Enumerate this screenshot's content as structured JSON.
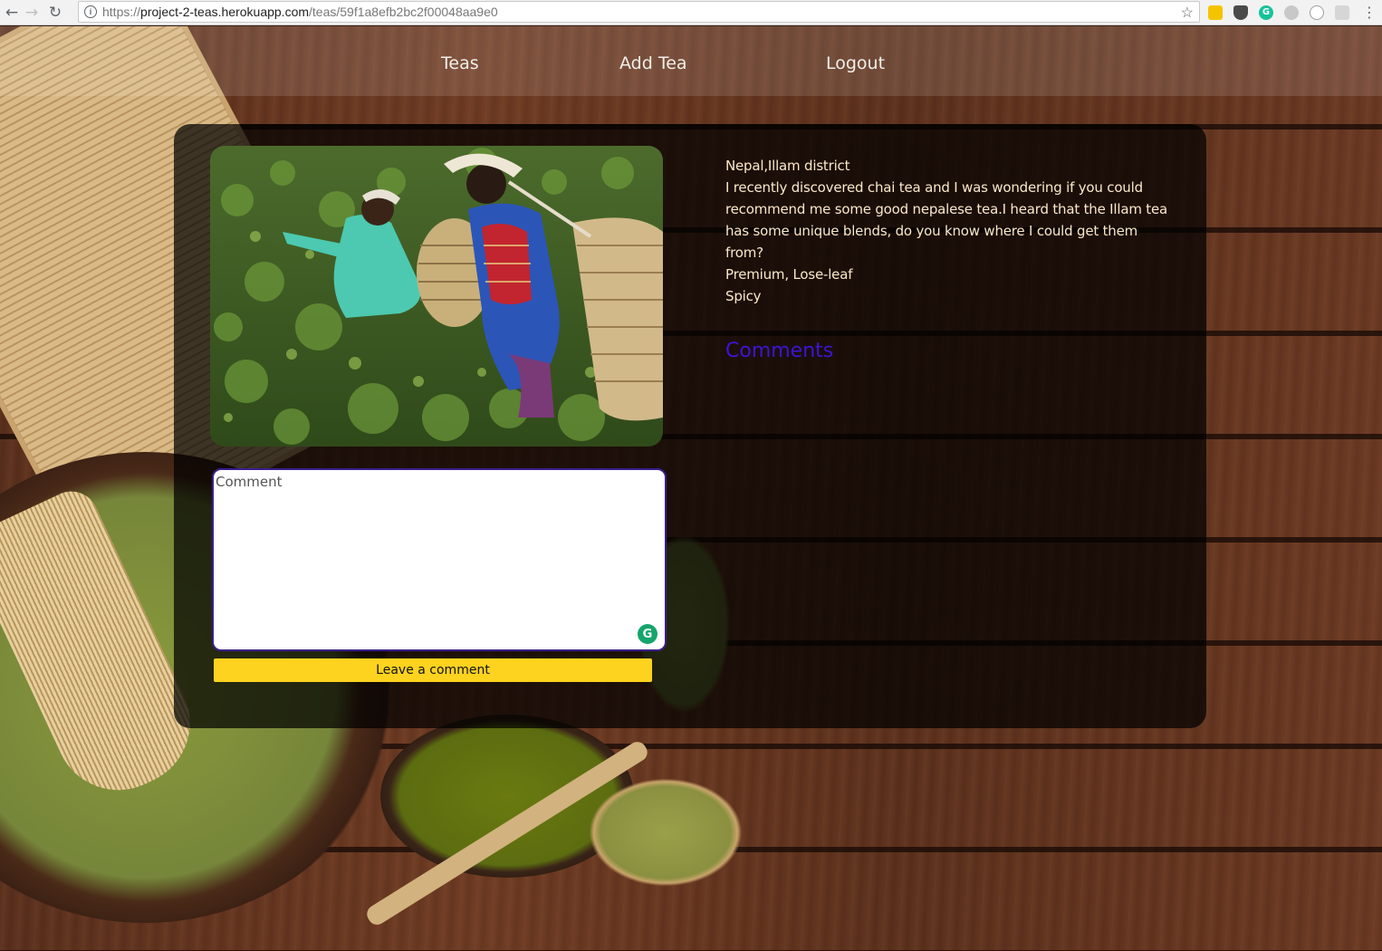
{
  "browser": {
    "url_protocol": "https://",
    "url_host": "project-2-teas.herokuapp.com",
    "url_path": "/teas/59f1a8efb2bc2f00048aa9e0",
    "icons": [
      "back-arrow-icon",
      "forward-arrow-icon",
      "reload-icon",
      "info-icon",
      "star-icon",
      "menu-dots-icon"
    ]
  },
  "nav": {
    "teas": "Teas",
    "add_tea": "Add Tea",
    "logout": "Logout"
  },
  "tea": {
    "origin": "Nepal,Illam district",
    "description": "I recently discovered chai tea and I was wondering if you could recommend me some good nepalese tea.I heard that the Illam tea has some unique blends, do you know where I could get them from?",
    "type": "Premium, Lose-leaf",
    "flavor": "Spicy"
  },
  "comments": {
    "heading": "Comments",
    "placeholder": "Comment",
    "submit_label": "Leave a comment"
  },
  "colors": {
    "accent_yellow": "#fdd31f",
    "comments_heading": "#3d14d6",
    "text_cream": "#fbe8c8"
  }
}
